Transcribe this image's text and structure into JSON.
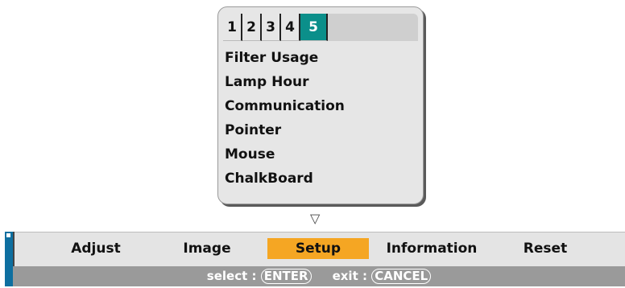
{
  "tabs": [
    "1",
    "2",
    "3",
    "4",
    "5"
  ],
  "active_tab": "5",
  "menu_items": [
    "Filter Usage",
    "Lamp Hour",
    "Communication",
    "Pointer",
    "Mouse",
    "ChalkBoard"
  ],
  "scroll_indicator": "▽",
  "main_menu": {
    "adjust": "Adjust",
    "image": "Image",
    "setup": "Setup",
    "information": "Information",
    "reset": "Reset"
  },
  "active_main_menu": "Setup",
  "hints": {
    "select_label": "select :",
    "select_key": "ENTER",
    "exit_label": "exit :",
    "exit_key": "CANCEL"
  },
  "colors": {
    "active_tab": "#0b8f8a",
    "active_menu": "#f5a623",
    "hint_bar": "#9a9a9a",
    "left_strip": "#0e6fa0"
  }
}
